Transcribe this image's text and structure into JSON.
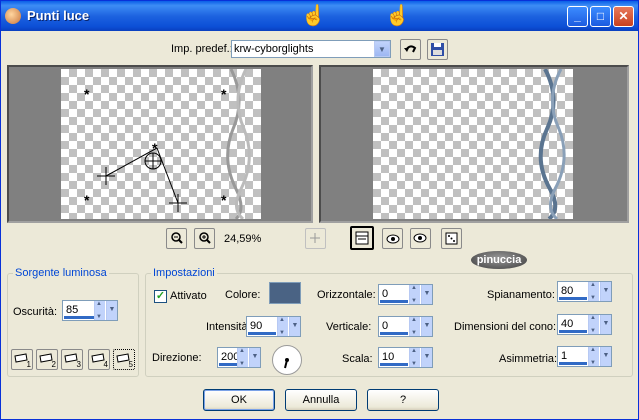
{
  "window": {
    "title": "Punti luce"
  },
  "preset": {
    "label": "Imp. predef.:",
    "value": "krw-cyborglights"
  },
  "zoom": {
    "value": "24,59%"
  },
  "badge": "pinuccia",
  "sorgente": {
    "title": "Sorgente luminosa",
    "oscurita_label": "Oscurità:",
    "oscurita_value": "85",
    "presets": [
      "1",
      "2",
      "3",
      "4",
      "5"
    ]
  },
  "impostazioni": {
    "title": "Impostazioni",
    "attivato_label": "Attivato",
    "colore_label": "Colore:",
    "colore_hex": "#4a6384",
    "intensita_label": "Intensità:",
    "intensita_value": "90",
    "direzione_label": "Direzione:",
    "direzione_value": "200",
    "orizzontale_label": "Orizzontale:",
    "orizzontale_value": "0",
    "verticale_label": "Verticale:",
    "verticale_value": "0",
    "scala_label": "Scala:",
    "scala_value": "10",
    "spianamento_label": "Spianamento:",
    "spianamento_value": "80",
    "cono_label": "Dimensioni del cono:",
    "cono_value": "40",
    "asimmetria_label": "Asimmetria:",
    "asimmetria_value": "1"
  },
  "buttons": {
    "ok": "OK",
    "annulla": "Annulla",
    "help": "?"
  }
}
